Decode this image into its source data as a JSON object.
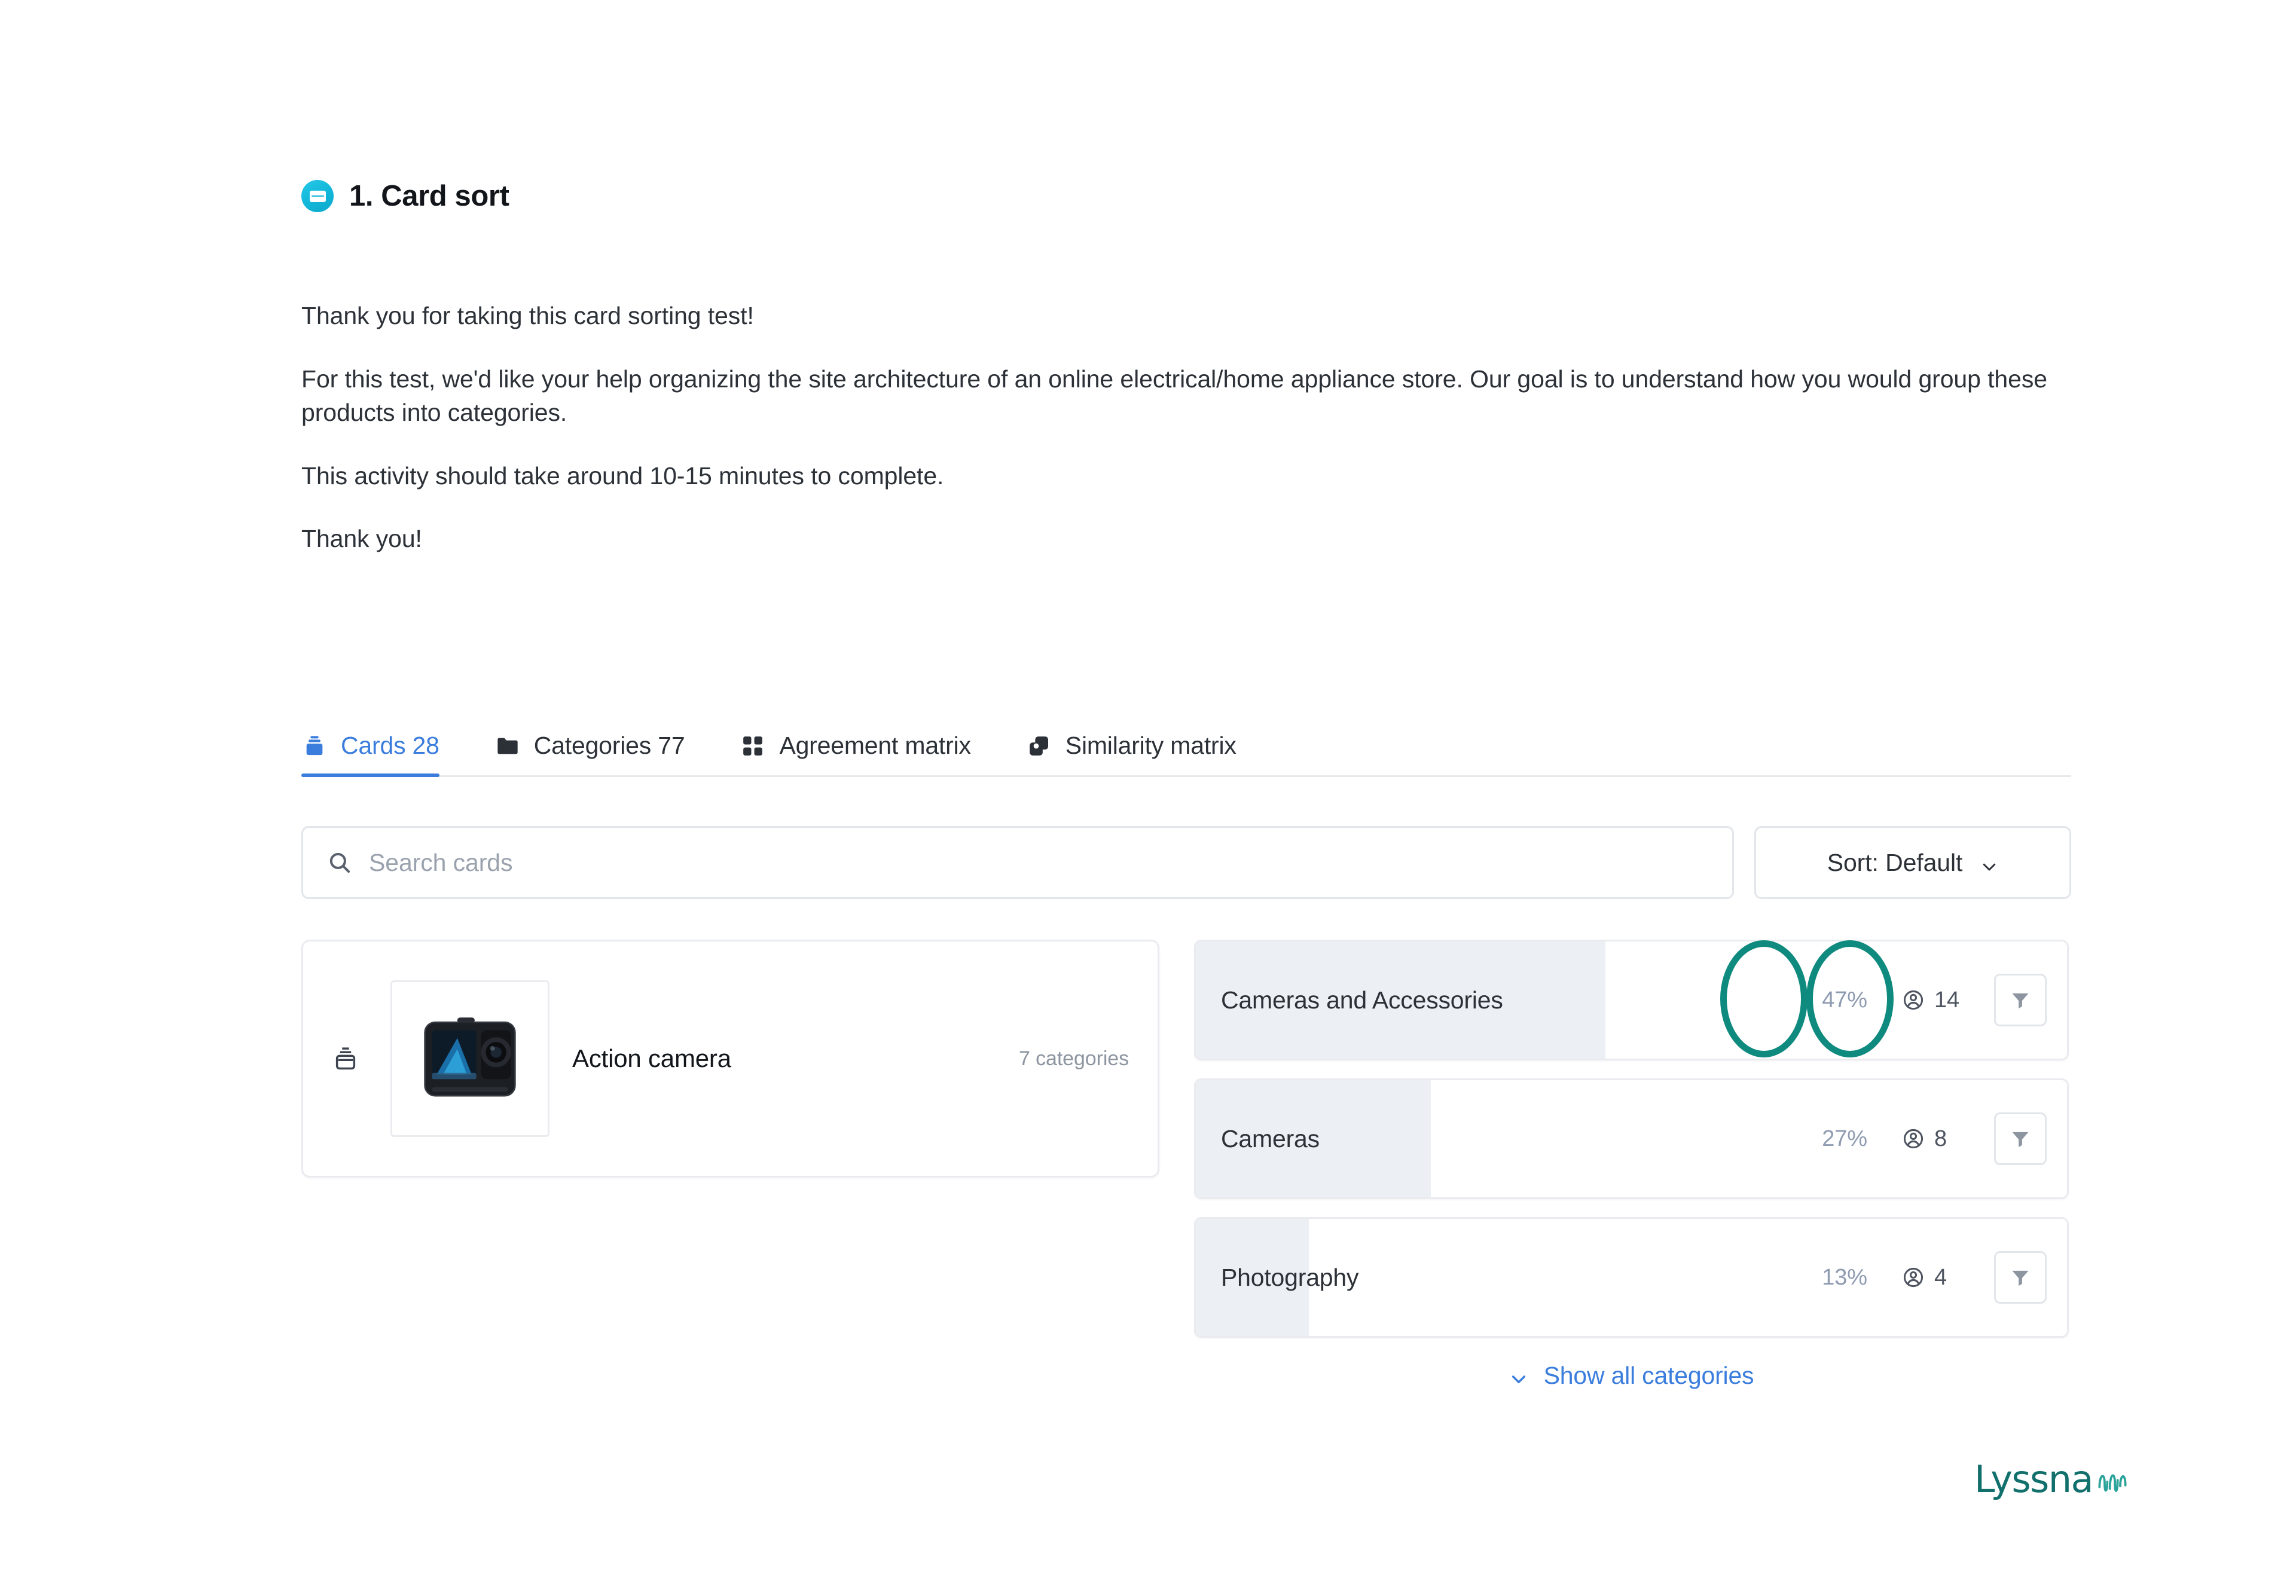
{
  "heading": {
    "icon": "card-sort-icon",
    "title": "1. Card sort"
  },
  "intro": {
    "paragraphs": [
      "Thank you for taking this card sorting test!",
      "For this test, we'd like your help organizing the site architecture of an online electrical/home appliance store. Our goal is to understand how you would group these products into categories.",
      "This activity should take around 10-15 minutes to complete.",
      "Thank you!"
    ]
  },
  "tabs": [
    {
      "label": "Cards 28",
      "icon": "cards-stack-icon",
      "active": true
    },
    {
      "label": "Categories 77",
      "icon": "folder-icon",
      "active": false
    },
    {
      "label": "Agreement matrix",
      "icon": "grid-four-icon",
      "active": false
    },
    {
      "label": "Similarity matrix",
      "icon": "overlapping-squares-icon",
      "active": false
    }
  ],
  "toolbar": {
    "search_placeholder": "Search cards",
    "search_value": "",
    "search_icon": "search-icon",
    "sort_label": "Sort: Default",
    "sort_chevron": "chevron-down-icon"
  },
  "card": {
    "drag_icon": "cards-stack-icon",
    "thumbnail": "action-camera-photo",
    "title": "Action camera",
    "meta": "7 categories"
  },
  "categories": {
    "rows": [
      {
        "name": "Cameras and Accessories",
        "percent_label": "47%",
        "percent_value": 47,
        "participants": "14",
        "person_icon": "person-icon",
        "filter_icon": "filter-icon"
      },
      {
        "name": "Cameras",
        "percent_label": "27%",
        "percent_value": 27,
        "participants": "8",
        "person_icon": "person-icon",
        "filter_icon": "filter-icon"
      },
      {
        "name": "Photography",
        "percent_label": "13%",
        "percent_value": 13,
        "participants": "4",
        "person_icon": "person-icon",
        "filter_icon": "filter-icon"
      }
    ],
    "show_all_label": "Show all categories",
    "show_all_icon": "chevron-down-icon"
  },
  "annotations": {
    "color": "#0f8a7e",
    "circles": [
      {
        "target": "percent-47",
        "shape": "ellipse"
      },
      {
        "target": "participants-14",
        "shape": "ellipse"
      }
    ]
  },
  "branding": {
    "name": "Lyssna",
    "mark": "sound-wave-icon",
    "color": "#11706c"
  },
  "theme": {
    "accent_blue": "#3b7ddd",
    "icon_cyan": "#12b6d8",
    "bar_grey": "#eceff4",
    "text_dark": "#2c3138",
    "text_muted": "#8d95a1"
  }
}
